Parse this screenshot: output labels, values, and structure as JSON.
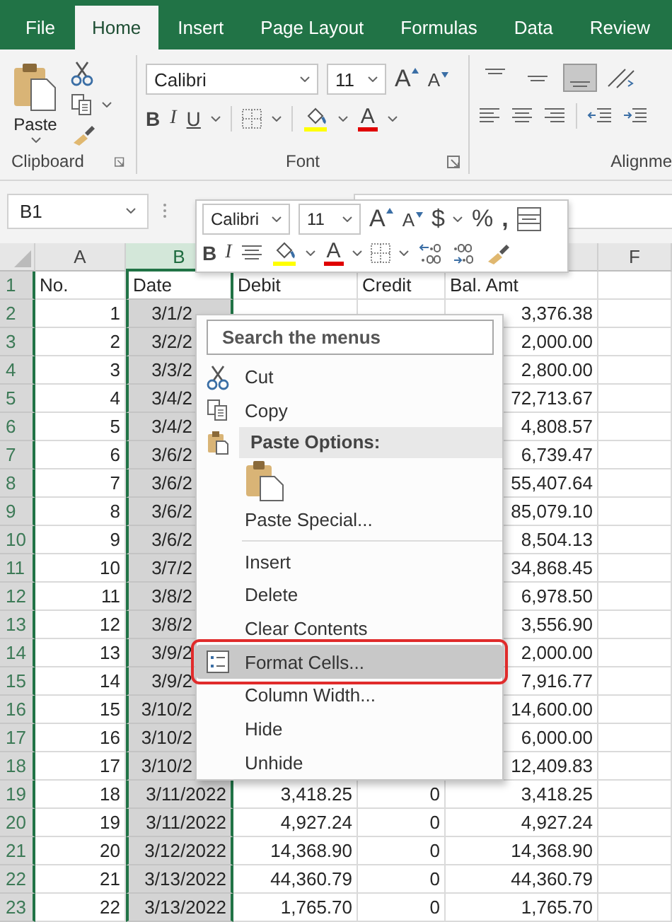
{
  "tabs": [
    {
      "label": "File",
      "selected": false
    },
    {
      "label": "Home",
      "selected": true
    },
    {
      "label": "Insert",
      "selected": false
    },
    {
      "label": "Page Layout",
      "selected": false
    },
    {
      "label": "Formulas",
      "selected": false
    },
    {
      "label": "Data",
      "selected": false
    },
    {
      "label": "Review",
      "selected": false
    }
  ],
  "ribbon": {
    "clipboard": {
      "label": "Clipboard",
      "paste": "Paste"
    },
    "font": {
      "label": "Font",
      "font_name": "Calibri",
      "font_size": "11",
      "grow": "A",
      "shrink": "A",
      "bold": "B",
      "italic": "I",
      "underline": "U",
      "font_color": "A"
    },
    "alignment": {
      "label": "Alignme",
      "vertical": [
        {
          "kind": "top",
          "selected": false
        },
        {
          "kind": "middle",
          "selected": false
        },
        {
          "kind": "bottom",
          "selected": true
        }
      ]
    }
  },
  "name_box": {
    "value": "B1"
  },
  "mini_toolbar": {
    "font_name": "Calibri",
    "font_size": "11",
    "grow": "A",
    "shrink": "A",
    "currency": "$",
    "percent": "%",
    "comma": ",",
    "bold": "B",
    "italic": "I",
    "font_color": "A"
  },
  "sheet": {
    "column_headers": [
      {
        "label": "A",
        "selected": false
      },
      {
        "label": "B",
        "selected": true
      },
      {
        "label": "F",
        "selected": false
      }
    ],
    "header_row": {
      "number": "1",
      "no": "No.",
      "date": "Date",
      "debit": "Debit",
      "credit": "Credit",
      "bal_amt": "Bal. Amt"
    },
    "rows": [
      {
        "number": "2",
        "no": "1",
        "date": "3/1/2",
        "bal_amt": "3,376.38"
      },
      {
        "number": "3",
        "no": "2",
        "date": "3/2/2",
        "bal_amt": "2,000.00"
      },
      {
        "number": "4",
        "no": "3",
        "date": "3/3/2",
        "bal_amt": "2,800.00"
      },
      {
        "number": "5",
        "no": "4",
        "date": "3/4/2",
        "bal_amt": "72,713.67"
      },
      {
        "number": "6",
        "no": "5",
        "date": "3/4/2",
        "bal_amt": "4,808.57"
      },
      {
        "number": "7",
        "no": "6",
        "date": "3/6/2",
        "bal_amt": "6,739.47"
      },
      {
        "number": "8",
        "no": "7",
        "date": "3/6/2",
        "bal_amt": "55,407.64"
      },
      {
        "number": "9",
        "no": "8",
        "date": "3/6/2",
        "bal_amt": "85,079.10"
      },
      {
        "number": "10",
        "no": "9",
        "date": "3/6/2",
        "bal_amt": "8,504.13"
      },
      {
        "number": "11",
        "no": "10",
        "date": "3/7/2",
        "bal_amt": "34,868.45"
      },
      {
        "number": "12",
        "no": "11",
        "date": "3/8/2",
        "bal_amt": "6,978.50"
      },
      {
        "number": "13",
        "no": "12",
        "date": "3/8/2",
        "bal_amt": "3,556.90"
      },
      {
        "number": "14",
        "no": "13",
        "date": "3/9/2",
        "bal_amt": "2,000.00"
      },
      {
        "number": "15",
        "no": "14",
        "date": "3/9/2",
        "bal_amt": "7,916.77"
      },
      {
        "number": "16",
        "no": "15",
        "date": "3/10/2",
        "bal_amt": "14,600.00"
      },
      {
        "number": "17",
        "no": "16",
        "date": "3/10/2",
        "bal_amt": "6,000.00"
      },
      {
        "number": "18",
        "no": "17",
        "date": "3/10/2",
        "bal_amt": "12,409.83"
      },
      {
        "number": "19",
        "no": "18",
        "date": "3/11/2022",
        "debit": "3,418.25",
        "credit": "0",
        "bal_amt": "3,418.25"
      },
      {
        "number": "20",
        "no": "19",
        "date": "3/11/2022",
        "debit": "4,927.24",
        "credit": "0",
        "bal_amt": "4,927.24"
      },
      {
        "number": "21",
        "no": "20",
        "date": "3/12/2022",
        "debit": "14,368.90",
        "credit": "0",
        "bal_amt": "14,368.90"
      },
      {
        "number": "22",
        "no": "21",
        "date": "3/13/2022",
        "debit": "44,360.79",
        "credit": "0",
        "bal_amt": "44,360.79"
      },
      {
        "number": "23",
        "no": "22",
        "date": "3/13/2022",
        "debit": "1,765.70",
        "credit": "0",
        "bal_amt": "1,765.70"
      }
    ]
  },
  "context_menu": {
    "search": {
      "placeholder": "Search the menus"
    },
    "items": [
      {
        "kind": "cut",
        "label": "Cut",
        "selected": false
      },
      {
        "kind": "copy",
        "label": "Copy",
        "selected": false
      },
      {
        "kind": "header",
        "label": "Paste Options:"
      },
      {
        "kind": "paste"
      },
      {
        "kind": "plain",
        "label": "Paste Special...",
        "selected": false
      },
      {
        "kind": "separator"
      },
      {
        "kind": "plain",
        "label": "Insert",
        "selected": false
      },
      {
        "kind": "plain",
        "label": "Delete",
        "selected": false
      },
      {
        "kind": "plain",
        "label": "Clear Contents",
        "selected": false
      },
      {
        "kind": "format",
        "label": "Format Cells...",
        "selected": true
      },
      {
        "kind": "plain",
        "label": "Column Width...",
        "selected": false
      },
      {
        "kind": "plain",
        "label": "Hide",
        "selected": false
      },
      {
        "kind": "plain",
        "label": "Unhide",
        "selected": false
      }
    ]
  }
}
